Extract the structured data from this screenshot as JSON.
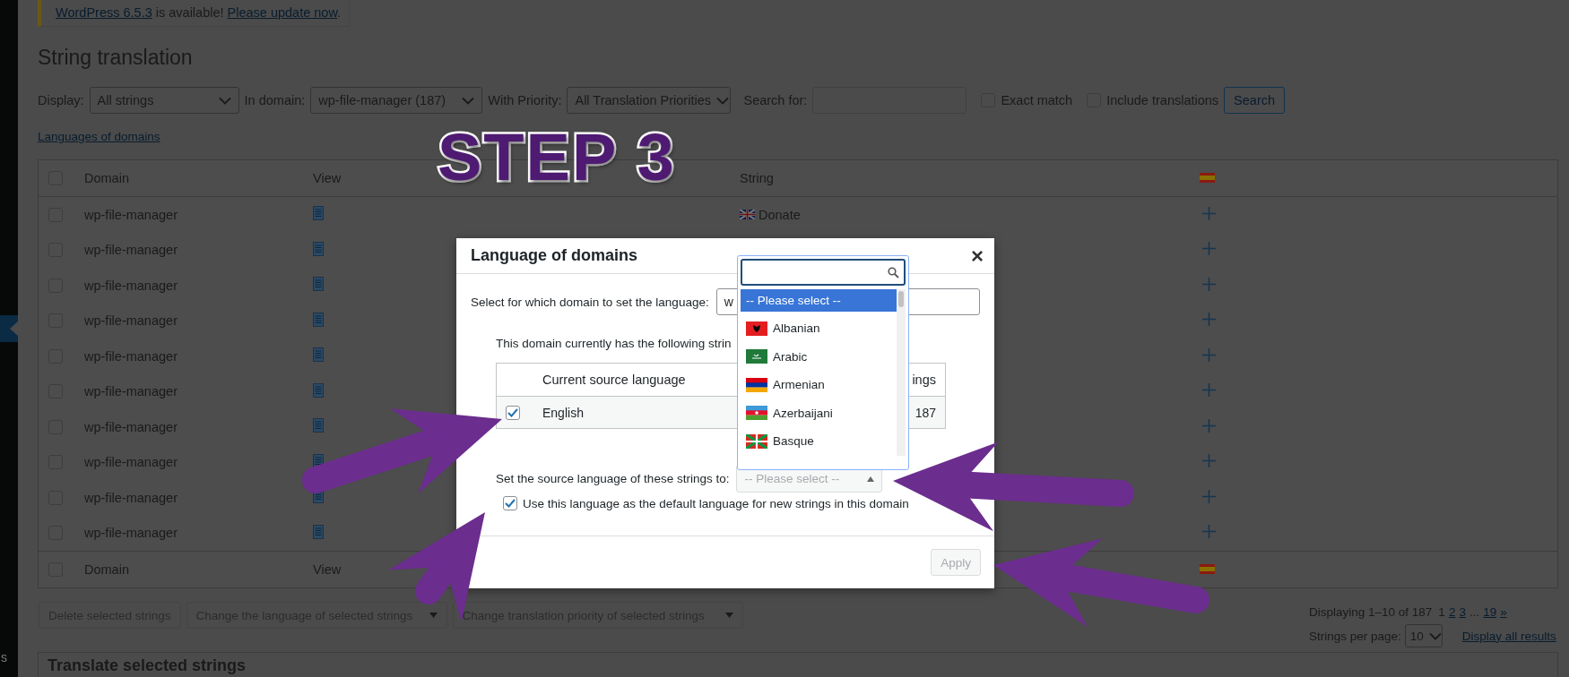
{
  "sidebar": {
    "label": "s"
  },
  "notice": {
    "version_link": "WordPress 6.5.3",
    "text": " is available! ",
    "update_link": "Please update now",
    "end": "."
  },
  "page_title": "String translation",
  "filters": [
    {
      "kind": "select",
      "label": "Display:",
      "value": "All strings"
    },
    {
      "kind": "select",
      "label": "In domain:",
      "value": "wp-file-manager (187)"
    },
    {
      "kind": "select",
      "label": "With Priority:",
      "value": "All Translation Priorities"
    },
    {
      "kind": "input",
      "label": "Search for:"
    },
    {
      "kind": "checkbox",
      "label": "Exact match",
      "checked": false
    },
    {
      "kind": "checkbox",
      "label": "Include translations",
      "checked": false
    },
    {
      "kind": "button",
      "label": "Search"
    }
  ],
  "languages_link": "Languages of domains",
  "table": {
    "select_all_checked": false,
    "columns": [
      "Domain",
      "View",
      "String"
    ],
    "rows": [
      {
        "checked": false,
        "domain": "wp-file-manager",
        "string": "Donate"
      },
      {
        "checked": false,
        "domain": "wp-file-manager"
      },
      {
        "checked": false,
        "domain": "wp-file-manager"
      },
      {
        "checked": false,
        "domain": "wp-file-manager"
      },
      {
        "checked": false,
        "domain": "wp-file-manager"
      },
      {
        "checked": false,
        "domain": "wp-file-manager"
      },
      {
        "checked": false,
        "domain": "wp-file-manager"
      },
      {
        "checked": false,
        "domain": "wp-file-manager"
      },
      {
        "checked": false,
        "domain": "wp-file-manager"
      },
      {
        "checked": false,
        "domain": "wp-file-manager"
      }
    ],
    "footer_columns": [
      "Domain",
      "View"
    ],
    "footer_select_all_checked": false
  },
  "bulk_actions": [
    {
      "kind": "button",
      "label": "Delete selected strings"
    },
    {
      "kind": "select",
      "label": "Change the language of selected strings"
    },
    {
      "kind": "select",
      "label": "Change translation priority of selected strings"
    }
  ],
  "pagination": {
    "summary": "Displaying 1–10 of 187",
    "pages": [
      {
        "kind": "page",
        "label": "1",
        "selected": true
      },
      {
        "kind": "page",
        "label": "2",
        "selected": false
      },
      {
        "kind": "page",
        "label": "3",
        "selected": false
      },
      {
        "kind": "gap",
        "label": "..."
      },
      {
        "kind": "page",
        "label": "19",
        "selected": false
      },
      {
        "kind": "page",
        "label": "»",
        "selected": false
      }
    ],
    "per_page_label": "Strings per page:",
    "per_page": "10",
    "display_all": "Display all results"
  },
  "translate_box": {
    "title": "Translate selected strings"
  },
  "step_label": "STEP 3",
  "modal": {
    "title": "Language of domains",
    "close": "×",
    "domain_label": "Select for which domain to set the language:",
    "domain_value": "w",
    "intro": "This domain currently has the following strin",
    "table": {
      "columns": [
        "Current source language",
        "ings"
      ],
      "rows": [
        {
          "checked": true,
          "language": "English",
          "count": "187"
        }
      ]
    },
    "source_label": "Set the source language of these strings to:",
    "source_placeholder": "-- Please select --",
    "source_disabled": true,
    "default_checkbox": {
      "label": "Use this language as the default language for new strings in this domain",
      "checked": true
    },
    "apply": {
      "label": "Apply",
      "disabled": true
    }
  },
  "dropdown": {
    "options": [
      {
        "label": "-- Please select --",
        "selected": true
      },
      {
        "label": "Albanian",
        "selected": false
      },
      {
        "label": "Arabic",
        "selected": false
      },
      {
        "label": "Armenian",
        "selected": false
      },
      {
        "label": "Azerbaijani",
        "selected": false
      },
      {
        "label": "Basque",
        "selected": false
      }
    ]
  }
}
